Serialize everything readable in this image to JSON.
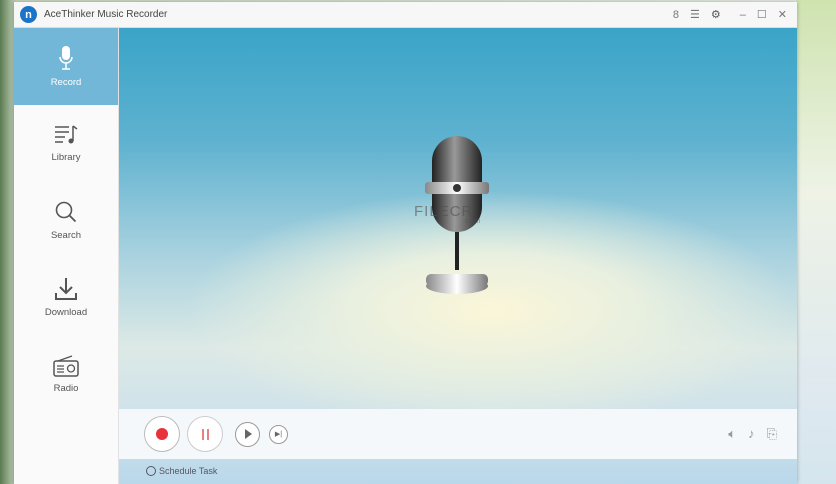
{
  "window": {
    "title": "AceThinker Music Recorder",
    "logo_letter": "n"
  },
  "sidebar": {
    "items": [
      {
        "label": "Record",
        "icon": "microphone-icon",
        "active": true
      },
      {
        "label": "Library",
        "icon": "music-list-icon"
      },
      {
        "label": "Search",
        "icon": "search-icon"
      },
      {
        "label": "Download",
        "icon": "download-icon"
      },
      {
        "label": "Radio",
        "icon": "radio-icon"
      }
    ]
  },
  "watermark": {
    "text": "FILECR",
    "sub": ".com"
  },
  "footer": {
    "schedule_label": "Schedule Task"
  },
  "colors": {
    "accent": "#73b7d8",
    "record": "#e8323c",
    "pause": "#e88080"
  }
}
